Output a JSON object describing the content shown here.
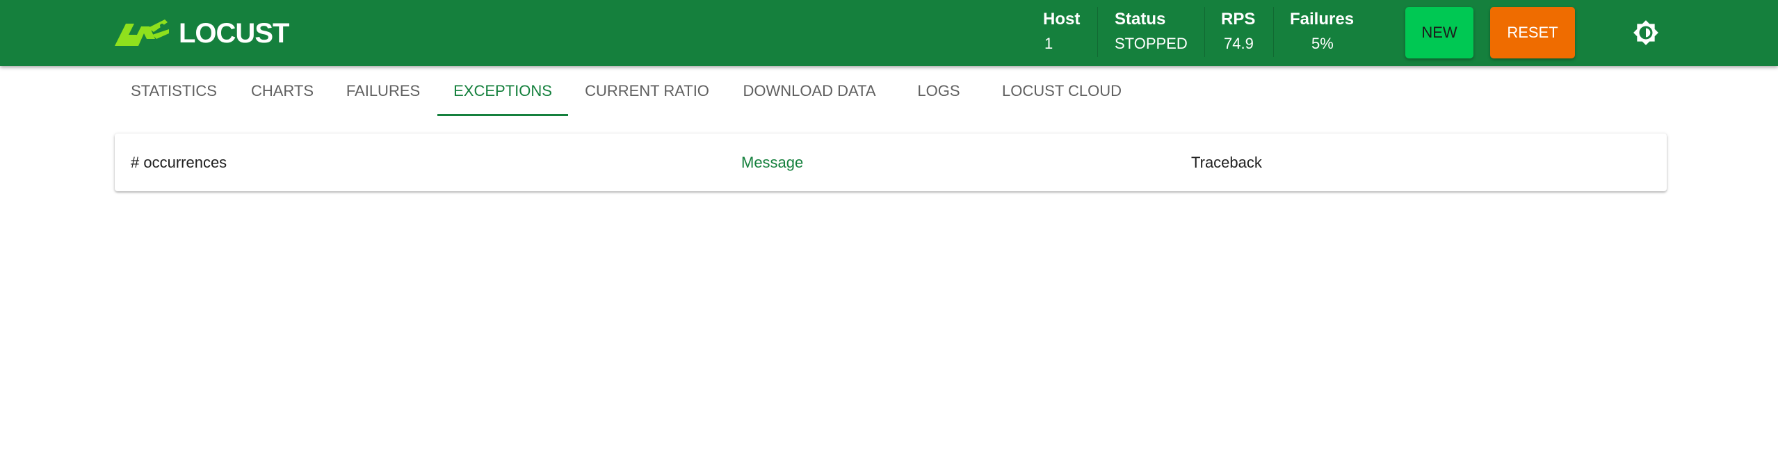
{
  "app": {
    "logo_text": "LOCUST",
    "colors": {
      "primary": "#15803d",
      "logo_accent": "#8fe01d",
      "new_button": "#00c853",
      "reset_button": "#ef6c00"
    }
  },
  "header": {
    "stats": {
      "host": {
        "label": "Host",
        "value": "1"
      },
      "status": {
        "label": "Status",
        "value": "STOPPED"
      },
      "rps": {
        "label": "RPS",
        "value": "74.9"
      },
      "failures": {
        "label": "Failures",
        "value": "5%"
      }
    },
    "buttons": {
      "new_label": "NEW",
      "reset_label": "RESET"
    },
    "theme_toggle_icon": "brightness-icon"
  },
  "tabs": [
    {
      "label": "STATISTICS",
      "active": false
    },
    {
      "label": "CHARTS",
      "active": false
    },
    {
      "label": "FAILURES",
      "active": false
    },
    {
      "label": "EXCEPTIONS",
      "active": true
    },
    {
      "label": "CURRENT RATIO",
      "active": false
    },
    {
      "label": "DOWNLOAD DATA",
      "active": false
    },
    {
      "label": "LOGS",
      "active": false
    },
    {
      "label": "LOCUST CLOUD",
      "active": false
    }
  ],
  "exceptions_table": {
    "columns": [
      {
        "label": "# occurrences",
        "sorted": false
      },
      {
        "label": "Message",
        "sorted": true
      },
      {
        "label": "Traceback",
        "sorted": false
      }
    ],
    "rows": []
  }
}
